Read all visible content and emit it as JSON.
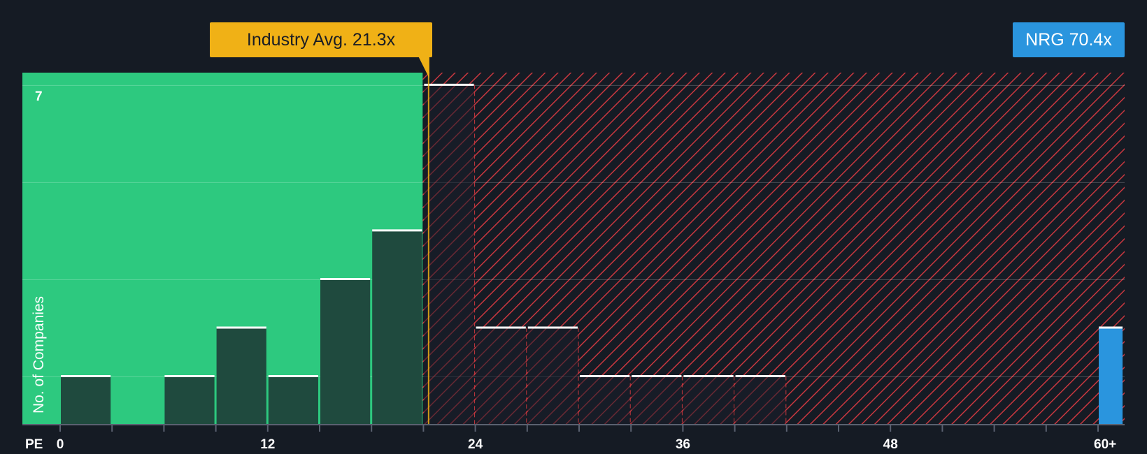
{
  "chart_data": {
    "type": "bar",
    "xlabel": "PE",
    "ylabel": "No. of Companies",
    "xlim": [
      0,
      61.5
    ],
    "ylim": [
      0,
      7.25
    ],
    "xticks": [
      0,
      12,
      24,
      36,
      48
    ],
    "xtick_labels": [
      "0",
      "12",
      "24",
      "36",
      "48",
      "60+"
    ],
    "ytick_label": "7",
    "grid": true,
    "bins": [
      {
        "x0": 0,
        "x1": 3,
        "count": 1
      },
      {
        "x0": 6,
        "x1": 9,
        "count": 1
      },
      {
        "x0": 9,
        "x1": 12,
        "count": 2
      },
      {
        "x0": 12,
        "x1": 15,
        "count": 1
      },
      {
        "x0": 15,
        "x1": 18,
        "count": 3
      },
      {
        "x0": 18,
        "x1": 21,
        "count": 4
      },
      {
        "x0": 21,
        "x1": 24,
        "count": 7
      },
      {
        "x0": 24,
        "x1": 27,
        "count": 2
      },
      {
        "x0": 27,
        "x1": 30,
        "count": 2
      },
      {
        "x0": 30,
        "x1": 33,
        "count": 1
      },
      {
        "x0": 33,
        "x1": 36,
        "count": 1
      },
      {
        "x0": 36,
        "x1": 39,
        "count": 1
      },
      {
        "x0": 39,
        "x1": 42,
        "count": 1
      },
      {
        "x0": 60,
        "x1": 61.5,
        "count": 2,
        "highlight": true
      }
    ],
    "industry_avg": 21.3,
    "industry_label": "Industry Avg. 21.3x",
    "company": "NRG",
    "company_value": 70.4,
    "company_label": "NRG 70.4x"
  },
  "colors": {
    "background": "#151b24",
    "fair_zone": "#2dc97f",
    "fair_bar": "#1f4a3e",
    "hatch": "#c8373f",
    "average": "#f0b116",
    "company": "#2a95de"
  }
}
